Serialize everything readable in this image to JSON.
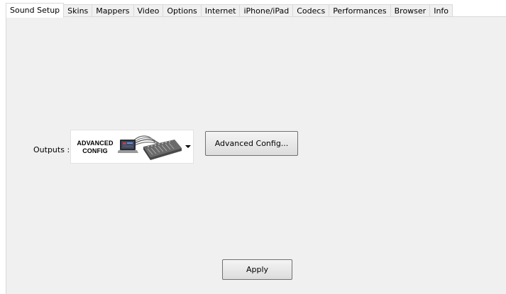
{
  "tabs": [
    {
      "label": "Sound Setup",
      "active": true
    },
    {
      "label": "Skins"
    },
    {
      "label": "Mappers"
    },
    {
      "label": "Video"
    },
    {
      "label": "Options"
    },
    {
      "label": "Internet"
    },
    {
      "label": "iPhone/iPad"
    },
    {
      "label": "Codecs"
    },
    {
      "label": "Performances"
    },
    {
      "label": "Browser"
    },
    {
      "label": "Info"
    }
  ],
  "sound_setup": {
    "outputs_label": "Outputs :",
    "outputs_selected_line1": "ADVANCED",
    "outputs_selected_line2": "CONFIG",
    "outputs_selected_icon": "laptop-mixer-icon",
    "advanced_config_button": "Advanced Config...",
    "apply_button": "Apply"
  }
}
